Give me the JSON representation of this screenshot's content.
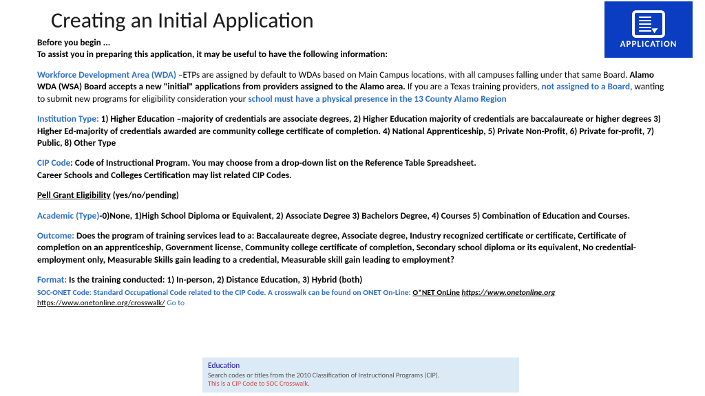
{
  "title": "Creating an Initial Application",
  "appIconLabel": "APPLICATION",
  "intro": {
    "line1": "Before you begin ...",
    "line2": " To assist you in preparing this application, it may be useful to have the following information:"
  },
  "wda": {
    "label": "Workforce Development Area (WDA) –",
    "text1": "ETPs are assigned by default to WDAs based on Main Campus locations, with all campuses falling under that same Board. ",
    "bold1": "Alamo WDA (WSA) Board accepts a new \"initial\" applications from providers assigned to the Alamo area. ",
    "text2": "If you are a Texas training providers, ",
    "blue2": "not assigned to a Board",
    "text3": ", wanting to submit new programs for eligibility consideration your ",
    "blue3": "school must have a physical presence in the 13 County Alamo Region"
  },
  "inst": {
    "label": " Institution Type:  ",
    "text": "1) Higher Education –majority of credentials are associate degrees, 2) Higher Education majority of credentials are baccalaureate or higher degrees 3) Higher Ed-majority of credentials awarded are community college certificate of completion. 4) National Apprenticeship, 5) Private Non-Profit, 6) Private for-profit, 7) Public, 8) Other Type"
  },
  "cip": {
    "label": "CIP Code",
    "text1": ": Code of Instructional Program.  You may choose from a drop-down list on the Reference Table Spreadsheet.",
    "text2": "Career Schools and Colleges Certification may list related CIP Codes."
  },
  "pell": {
    "label": "Pell Grant Eligibility",
    "text": " (yes/no/pending)"
  },
  "academic": {
    "label": "Academic (Type)",
    "text": "-0)None, 1)High School Diploma or Equivalent, 2) Associate Degree 3) Bachelors Degree, 4) Courses 5) Combination of Education and Courses."
  },
  "outcome": {
    "label": "Outcome:  ",
    "text": "Does the program of training services lead to a: Baccalaureate degree, Associate degree, Industry recognized certificate or certificate, Certificate of completion on an apprenticeship, Government license, Community college certificate of completion, Secondary school diploma or its equivalent, No credential-employment only, Measurable Skills  gain leading to a credential, Measurable skill gain leading to employment?"
  },
  "format": {
    "label": "Format: ",
    "text": "Is the training conducted: 1) In-person, 2) Distance Education, 3) Hybrid (both)"
  },
  "soc": {
    "blueText": "SOC-ONET Code: Standard Occupational Code related to the CIP Code.  A crosswalk can be found on ONET On-Line:  ",
    "link1": "O*NET OnLine",
    "sep": "  ",
    "link2": "https://www.onetonline.org",
    "link3": "https://www.onetonline.org/crosswalk/",
    "goto": "   Go to"
  },
  "snippet": {
    "title": "Education",
    "desc": "Search codes or titles from the 2010 Classification of Instructional Programs (CIP).",
    "note": "This is a CIP Code to SOC Crosswalk."
  }
}
